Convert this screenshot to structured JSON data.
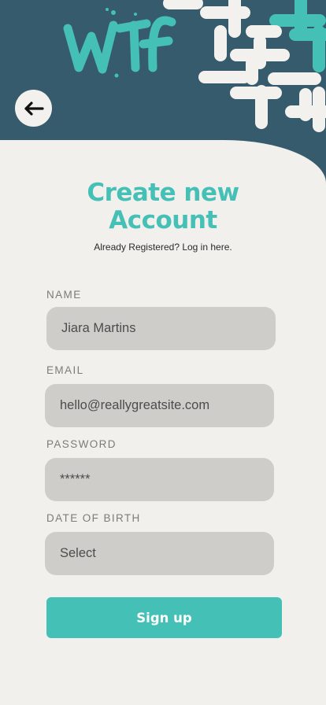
{
  "header": {
    "logo_text": "WTf",
    "back_icon": "arrow-left-icon"
  },
  "form": {
    "title_line1": "Create new",
    "title_line2": "Account",
    "subtitle": "Already Registered? Log in here.",
    "name_label": "NAME",
    "name_value": "Jiara Martins",
    "email_label": "EMAIL",
    "email_value": "hello@reallygreatsite.com",
    "password_label": "PASSWORD",
    "password_value": "******",
    "dob_label": "DATE OF BIRTH",
    "dob_value": "Select",
    "signup_label": "Sign up"
  },
  "colors": {
    "header_bg": "#355b6d",
    "accent": "#45c0b7",
    "card_bg": "#f2f0ec",
    "field_bg": "#cfcdca"
  }
}
